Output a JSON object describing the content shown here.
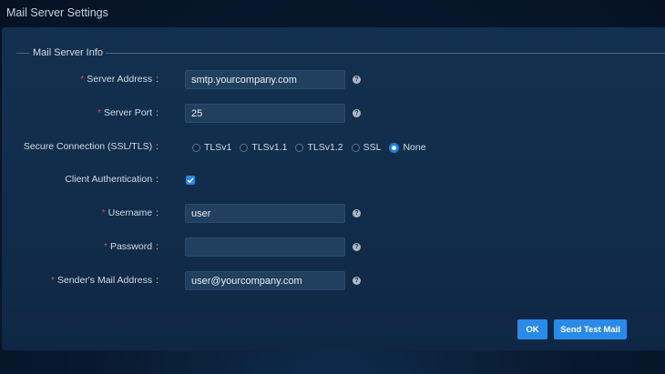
{
  "window": {
    "title": "Mail Server Settings"
  },
  "section": {
    "legend": "Mail Server Info"
  },
  "form": {
    "required_mark": "*",
    "colon": ":",
    "help_glyph": "?",
    "server_address": {
      "label": "Server Address",
      "value": "smtp.yourcompany.com"
    },
    "server_port": {
      "label": "Server Port",
      "value": "25"
    },
    "secure_connection": {
      "label": "Secure Connection (SSL/TLS)",
      "options": [
        "TLSv1",
        "TLSv1.1",
        "TLSv1.2",
        "SSL",
        "None"
      ],
      "selected": "None"
    },
    "client_auth": {
      "label": "Client Authentication",
      "checked": true
    },
    "username": {
      "label": "Username",
      "value": "user"
    },
    "password": {
      "label": "Password",
      "value": ""
    },
    "sender_address": {
      "label": "Sender's Mail Address",
      "value": "user@yourcompany.com"
    }
  },
  "buttons": {
    "ok": "OK",
    "send_test": "Send Test Mail"
  },
  "colors": {
    "accent": "#2a8ae8",
    "required": "#e0463c",
    "panel": "#12304f"
  }
}
